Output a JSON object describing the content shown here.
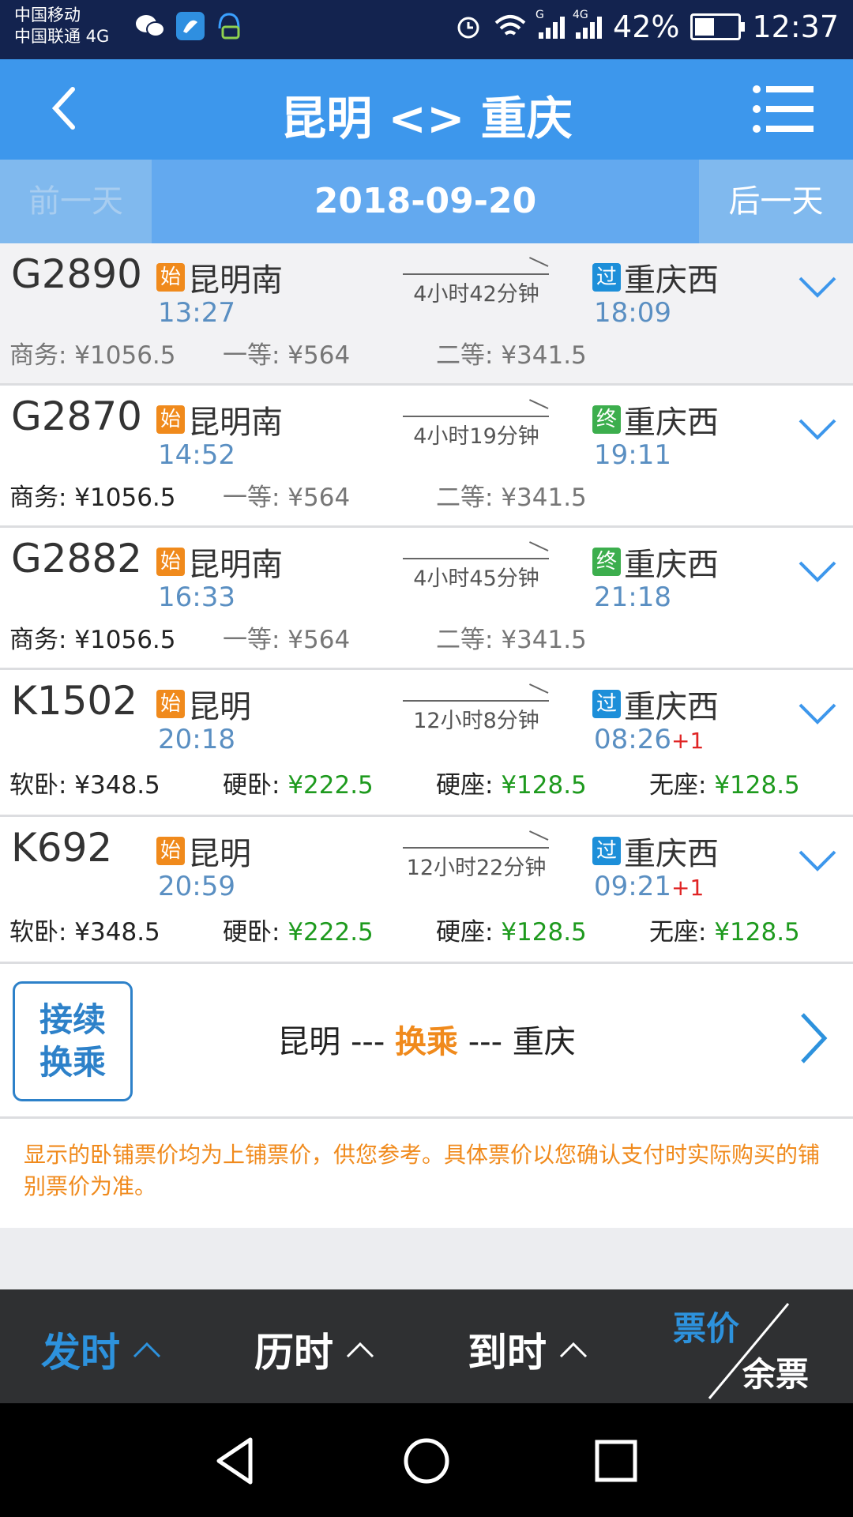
{
  "status_bar": {
    "carrier1": "中国移动",
    "carrier2": "中国联通 4G",
    "sig1_tag": "G",
    "sig2_tag": "4G",
    "battery": "42%",
    "time": "12:37"
  },
  "header": {
    "title": "昆明 <> 重庆",
    "back_icon": "chevron-left-icon",
    "menu_icon": "list-menu-icon"
  },
  "date_bar": {
    "prev": "前一天",
    "date": "2018-09-20",
    "next": "后一天"
  },
  "trains": [
    {
      "no": "G2890",
      "from_badge": "始",
      "from": "昆明南",
      "dep": "13:27",
      "duration": "4小时42分钟",
      "to_badge": "过",
      "to": "重庆西",
      "arr": "18:09",
      "arr_plus": "",
      "p1": "商务: ¥1056.5",
      "p2": "一等: ¥564",
      "p3_label": "二等: ",
      "p3_val": "¥341.5",
      "p4_label": "",
      "p4_val": ""
    },
    {
      "no": "G2870",
      "from_badge": "始",
      "from": "昆明南",
      "dep": "14:52",
      "duration": "4小时19分钟",
      "to_badge": "终",
      "to": "重庆西",
      "arr": "19:11",
      "arr_plus": "",
      "p1": "商务: ¥1056.5",
      "p2": "一等: ¥564",
      "p3_label": "二等: ",
      "p3_val": "¥341.5",
      "p4_label": "",
      "p4_val": ""
    },
    {
      "no": "G2882",
      "from_badge": "始",
      "from": "昆明南",
      "dep": "16:33",
      "duration": "4小时45分钟",
      "to_badge": "终",
      "to": "重庆西",
      "arr": "21:18",
      "arr_plus": "",
      "p1": "商务: ¥1056.5",
      "p2": "一等: ¥564",
      "p3_label": "二等: ",
      "p3_val": "¥341.5",
      "p4_label": "",
      "p4_val": ""
    },
    {
      "no": "K1502",
      "from_badge": "始",
      "from": "昆明",
      "dep": "20:18",
      "duration": "12小时8分钟",
      "to_badge": "过",
      "to": "重庆西",
      "arr": "08:26",
      "arr_plus": "+1",
      "p1": "软卧: ¥348.5",
      "p2_label": "硬卧: ",
      "p2_val": "¥222.5",
      "p3_label": "硬座: ",
      "p3_val": "¥128.5",
      "p4_label": "无座: ",
      "p4_val": "¥128.5"
    },
    {
      "no": "K692",
      "from_badge": "始",
      "from": "昆明",
      "dep": "20:59",
      "duration": "12小时22分钟",
      "to_badge": "过",
      "to": "重庆西",
      "arr": "09:21",
      "arr_plus": "+1",
      "p1": "软卧: ¥348.5",
      "p2_label": "硬卧: ",
      "p2_val": "¥222.5",
      "p3_label": "硬座: ",
      "p3_val": "¥128.5",
      "p4_label": "无座: ",
      "p4_val": "¥128.5"
    }
  ],
  "transfer": {
    "btn_line1": "接续",
    "btn_line2": "换乘",
    "from": "昆明",
    "sep1": " --- ",
    "mid": "换乘",
    "sep2": " --- ",
    "to": "重庆"
  },
  "note": "显示的卧铺票价均为上铺票价，供您参考。具体票价以您确认支付时实际购买的铺别票价为准。",
  "bottom_bar": {
    "sort_depart": "发时",
    "sort_duration": "历时",
    "sort_arrive": "到时",
    "price": "票价",
    "remain": "余票"
  },
  "colors": {
    "header": "#3d97ec",
    "status_bar": "#13234f",
    "badge_start": "#f08a1c",
    "badge_pass": "#1d8fd9",
    "badge_end": "#3cae4d",
    "price_green": "#1e9a1e",
    "accent_orange": "#f08a1c"
  }
}
